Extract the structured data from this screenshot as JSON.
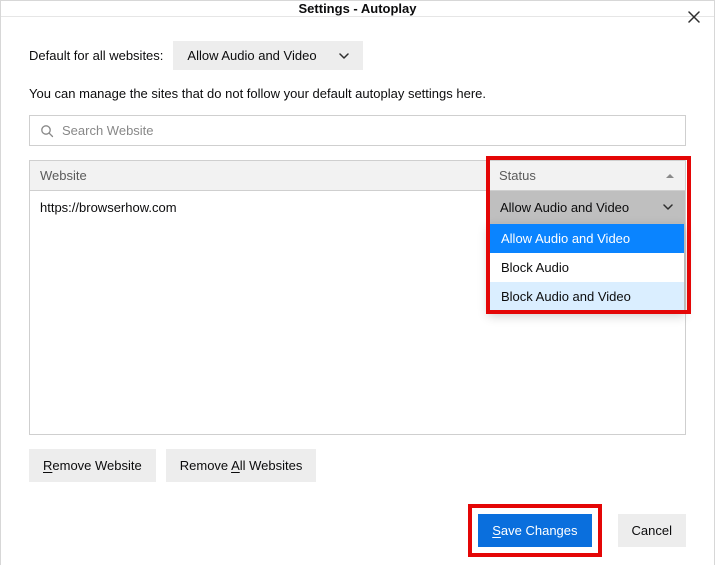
{
  "header": {
    "title": "Settings - Autoplay"
  },
  "default_row": {
    "label": "Default for all websites:",
    "value": "Allow Audio and Video"
  },
  "description": "You can manage the sites that do not follow your default autoplay settings here.",
  "search": {
    "placeholder": "Search Website"
  },
  "table": {
    "headers": {
      "website": "Website",
      "status": "Status"
    },
    "rows": [
      {
        "website": "https://browserhow.com",
        "status": "Allow Audio and Video"
      }
    ],
    "status_options": [
      "Allow Audio and Video",
      "Block Audio",
      "Block Audio and Video"
    ]
  },
  "buttons": {
    "remove_website": "Remove Website",
    "remove_all": "Remove All Websites",
    "save": "Save Changes",
    "cancel": "Cancel"
  }
}
